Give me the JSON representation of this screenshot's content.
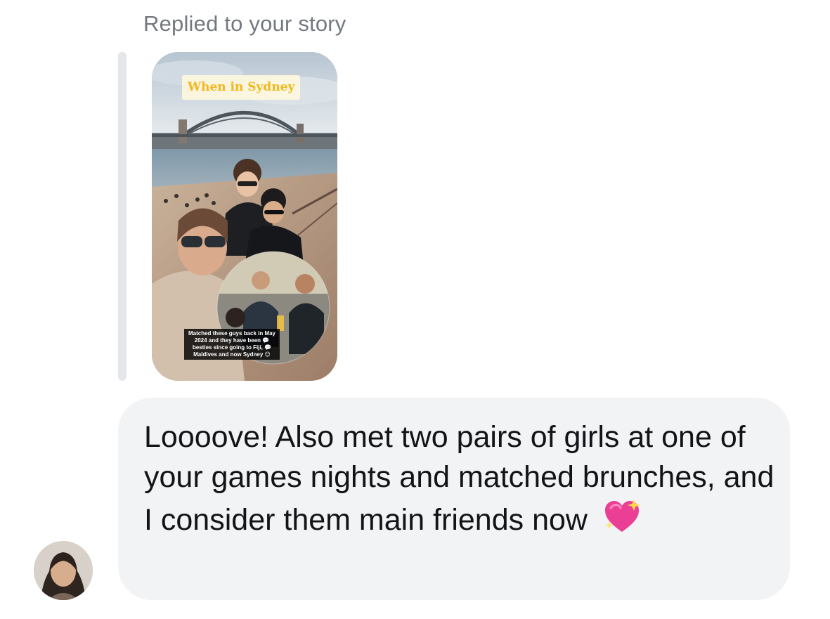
{
  "reply": {
    "label": "Replied to your story"
  },
  "story": {
    "title_sticker": "When in Sydney",
    "caption": "Matched these guys back in May 2024 and they have been 💬 besties since going to Fiji, 💬 Maldives and now Sydney 😊"
  },
  "message": {
    "text": "Loooove! Also met two pairs of girls at one of your games nights and matched brunches, and I consider them main friends now",
    "emoji": "sparkling-heart-icon"
  },
  "colors": {
    "reply_label": "#737880",
    "bubble_background": "#f2f3f5",
    "message_text": "#121417",
    "story_title_text": "#f2b81c"
  }
}
